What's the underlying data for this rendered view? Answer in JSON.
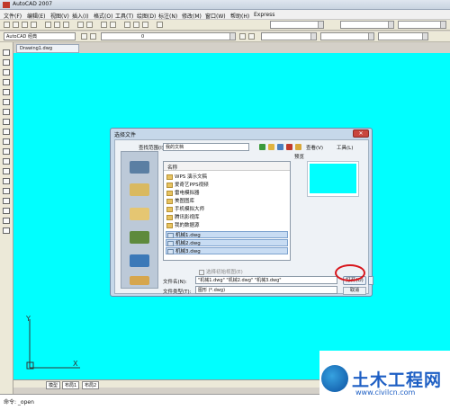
{
  "app": {
    "title": "AutoCAD 2007"
  },
  "menu": {
    "items": [
      "文件(F)",
      "编辑(E)",
      "视图(V)",
      "插入(I)",
      "格式(O)",
      "工具(T)",
      "绘图(D)",
      "标注(N)",
      "修改(M)",
      "窗口(W)",
      "帮助(H)",
      "Express"
    ]
  },
  "toolbar": {
    "workspace_combo": "AutoCAD 经典",
    "layer_value": "0"
  },
  "document": {
    "tab_label": "Drawing1.dwg"
  },
  "layout_tabs": [
    "模型",
    "布局1",
    "布局2"
  ],
  "command_line": {
    "prompt": "命令: _open"
  },
  "dialog": {
    "title": "选择文件",
    "lookin_label": "查找范围(I):",
    "lookin_value": "我的文档",
    "views_label": "查看(V)",
    "tools_label": "工具(L)",
    "list_header": "名称",
    "preview_label": "预览",
    "places": [
      "历史记录",
      "我的文档",
      "收藏夹",
      "FTP",
      "桌面",
      "Buzzsaw"
    ],
    "files": [
      {
        "name": "WPS 演示文稿",
        "kind": "folder"
      },
      {
        "name": "爱奇艺PPS视频",
        "kind": "folder"
      },
      {
        "name": "雷电模拟器",
        "kind": "folder"
      },
      {
        "name": "美图图库",
        "kind": "folder"
      },
      {
        "name": "手机模拟大师",
        "kind": "folder"
      },
      {
        "name": "腾讯影视库",
        "kind": "folder"
      },
      {
        "name": "我的数据源",
        "kind": "folder"
      },
      {
        "name": "机械1.dwg",
        "kind": "dwg"
      },
      {
        "name": "机械2.dwg",
        "kind": "dwg"
      },
      {
        "name": "机械3.dwg",
        "kind": "dwg"
      }
    ],
    "initial_view_label": "选择初始视图(E)",
    "filename_label": "文件名(N):",
    "filename_value": "\"机械1.dwg\" \"机械2.dwg\" \"机械3.dwg\"",
    "filetype_label": "文件类型(T):",
    "filetype_value": "图形 (*.dwg)",
    "open_label": "打开(O)",
    "cancel_label": "取消"
  },
  "watermark": {
    "title": "土木工程网",
    "url": "www.civilcn.com"
  },
  "colors": {
    "canvas": "#00ffff",
    "highlight": "#d8151b",
    "brand": "#1e5fc4"
  }
}
